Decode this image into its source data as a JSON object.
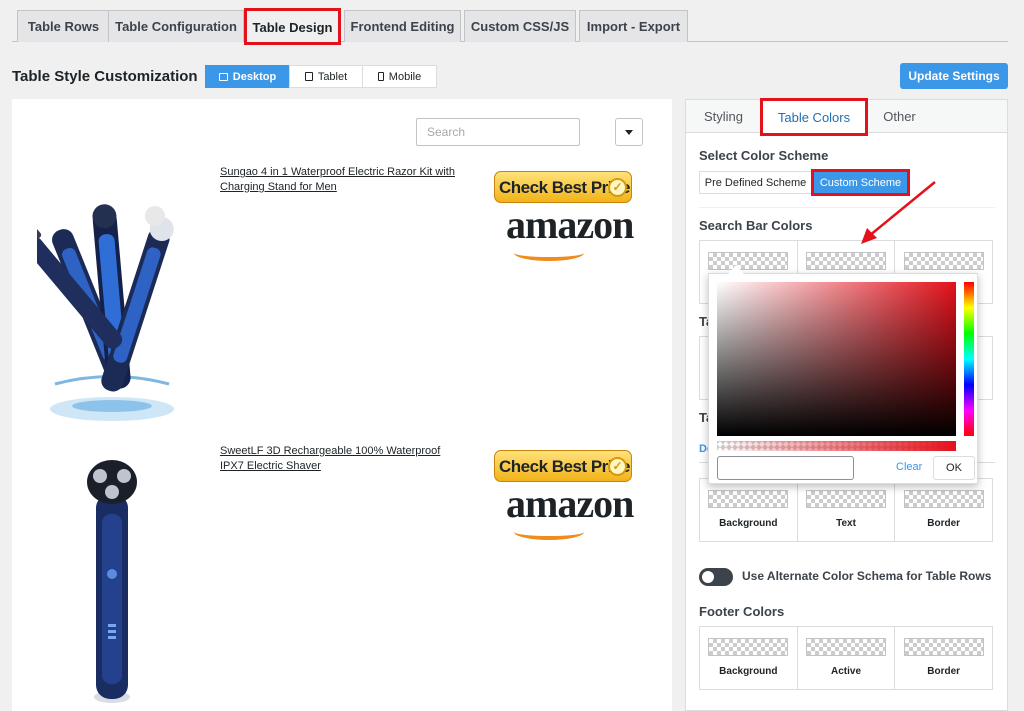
{
  "top_tabs": [
    {
      "label": "Table Rows"
    },
    {
      "label": "Table Configuration"
    },
    {
      "label": "Table Design"
    },
    {
      "label": "Frontend Editing"
    },
    {
      "label": "Custom CSS/JS"
    },
    {
      "label": "Import - Export"
    }
  ],
  "active_top_tab": "Table Design",
  "header": {
    "title": "Table Style Customization",
    "devices": [
      {
        "label": "Desktop",
        "icon": "desktop-icon"
      },
      {
        "label": "Tablet",
        "icon": "tablet-icon"
      },
      {
        "label": "Mobile",
        "icon": "mobile-icon"
      }
    ],
    "active_device": "Desktop",
    "update_button": "Update Settings"
  },
  "preview": {
    "search_placeholder": "Search",
    "products": [
      {
        "title": "Sungao 4 in 1 Waterproof Electric Razor Kit with Charging Stand for Men",
        "badge_text": "Check Best Price",
        "brand": "amazon"
      },
      {
        "title": "SweetLF 3D Rechargeable 100% Waterproof IPX7 Electric Shaver",
        "badge_text": "Check Best Price",
        "brand": "amazon"
      }
    ]
  },
  "panel": {
    "tabs": [
      {
        "label": "Styling"
      },
      {
        "label": "Table Colors"
      },
      {
        "label": "Other"
      }
    ],
    "active_tab": "Table Colors",
    "select_color_scheme": "Select Color Scheme",
    "scheme_options": [
      {
        "label": "Pre Defined Scheme"
      },
      {
        "label": "Custom Scheme"
      }
    ],
    "active_scheme": "Custom Scheme",
    "search_bar_colors": "Search Bar Colors",
    "hidden_heading_1": "Ta",
    "hidden_heading_2": "Ta",
    "hidden_tab_partial": "De",
    "row_color_labels": [
      "Background",
      "Text",
      "Border"
    ],
    "toggle_label": "Use Alternate Color Schema for Table Rows",
    "toggle_on": false,
    "footer_colors": "Footer Colors",
    "footer_labels": [
      "Background",
      "Active",
      "Border"
    ]
  },
  "color_picker": {
    "hex_value": "",
    "clear_label": "Clear",
    "ok_label": "OK"
  },
  "colors": {
    "accent": "#3b97e8",
    "highlight": "#e3111b"
  }
}
